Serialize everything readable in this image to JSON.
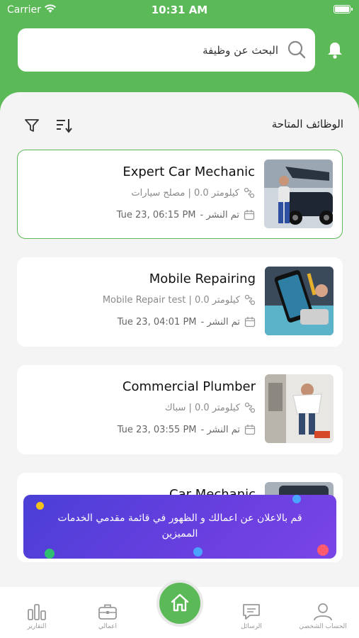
{
  "status_bar": {
    "carrier": "Carrier",
    "time": "10:31 AM"
  },
  "search": {
    "placeholder": "البحث عن وظيفة"
  },
  "section": {
    "title": "الوظائف المتاحة"
  },
  "jobs": [
    {
      "title": "Expert Car Mechanic",
      "distance": "كيلومتر 0.0 | مصلح سيارات",
      "posted_label": "تم النشر -",
      "date": "Tue 23, 06:15 PM",
      "selected": true,
      "thumb": "car-mechanic-photo"
    },
    {
      "title": "Mobile Repairing",
      "distance": "كيلومتر 0.0 | Mobile Repair test",
      "posted_label": "تم النشر -",
      "date": "Tue 23, 04:01 PM",
      "selected": false,
      "thumb": "phone-repair-photo"
    },
    {
      "title": "Commercial Plumber",
      "distance": "كيلومتر 0.0 | سباك",
      "posted_label": "تم النشر -",
      "date": "Tue 23, 03:55 PM",
      "selected": false,
      "thumb": "plumber-photo"
    },
    {
      "title": "Car Mechanic",
      "thumb": "car-mechanic-photo"
    }
  ],
  "banner": {
    "text": "قم بالاعلان عن اعمالك و الظهور في قائمة مقدمي الخدمات المميزين"
  },
  "tabbar": {
    "reports": "التقارير",
    "business": "اعمالي",
    "messages": "الرسائل",
    "profile": "الحساب الشخصي"
  },
  "colors": {
    "primary": "#5cb957",
    "banner": "#5a3fe0"
  }
}
